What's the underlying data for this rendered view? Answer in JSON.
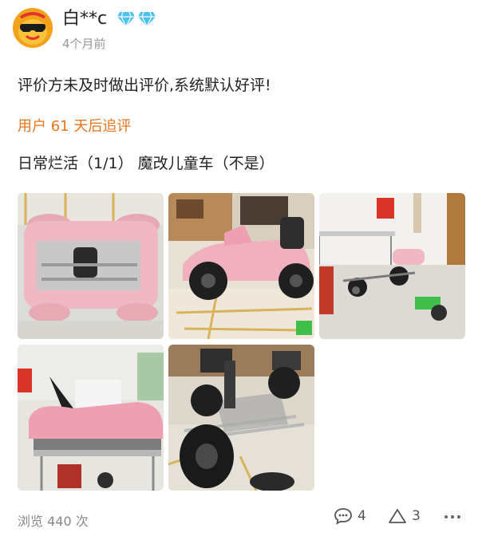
{
  "post": {
    "username": "白**c",
    "time_ago": "4个月前",
    "auto_review_text": "评价方未及时做出评价,系统默认好评!",
    "followup_label": "用户 61 天后追评",
    "followup_text": "日常烂活（1/1） 魔改儿童车（不是）",
    "views_text": "浏览 440 次",
    "comment_count": "4",
    "like_count": "3"
  },
  "colors": {
    "accent": "#e8741c",
    "gem": "#4cc3ef",
    "avatar_bg": "#f4a21a"
  },
  "icons": {
    "avatar": "sunglasses-mascot-avatar",
    "badge": "diamond-icon",
    "comment": "comment-icon",
    "like": "triangle-like-icon",
    "more": "more-icon"
  }
}
